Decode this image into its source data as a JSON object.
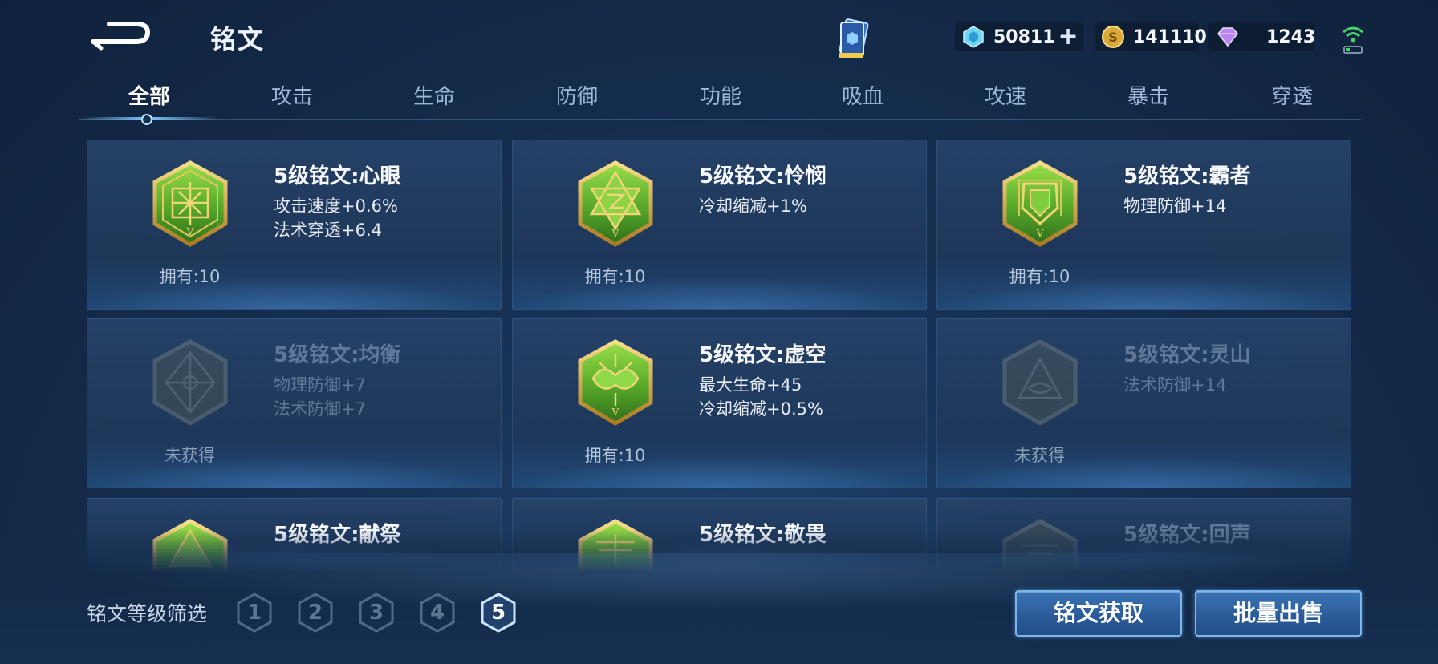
{
  "header": {
    "title": "铭文",
    "currencies": {
      "gems": "50811",
      "coins": "141110",
      "crystal": "1243"
    }
  },
  "tabs": [
    {
      "label": "全部",
      "active": true
    },
    {
      "label": "攻击"
    },
    {
      "label": "生命"
    },
    {
      "label": "防御"
    },
    {
      "label": "功能"
    },
    {
      "label": "吸血"
    },
    {
      "label": "攻速"
    },
    {
      "label": "暴击"
    },
    {
      "label": "穿透"
    }
  ],
  "inscriptions": [
    {
      "name": "5级铭文:心眼",
      "stat1": "攻击速度+0.6%",
      "stat2": "法术穿透+6.4",
      "count": "拥有:10",
      "owned": true
    },
    {
      "name": "5级铭文:怜悯",
      "stat1": "冷却缩减+1%",
      "stat2": "",
      "count": "拥有:10",
      "owned": true
    },
    {
      "name": "5级铭文:霸者",
      "stat1": "物理防御+14",
      "stat2": "",
      "count": "拥有:10",
      "owned": true
    },
    {
      "name": "5级铭文:均衡",
      "stat1": "物理防御+7",
      "stat2": "法术防御+7",
      "count": "未获得",
      "owned": false
    },
    {
      "name": "5级铭文:虚空",
      "stat1": "最大生命+45",
      "stat2": "冷却缩减+0.5%",
      "count": "拥有:10",
      "owned": true
    },
    {
      "name": "5级铭文:灵山",
      "stat1": "法术防御+14",
      "stat2": "",
      "count": "未获得",
      "owned": false
    },
    {
      "name": "5级铭文:献祭",
      "stat1": "",
      "stat2": "",
      "count": "",
      "owned": true
    },
    {
      "name": "5级铭文:敬畏",
      "stat1": "",
      "stat2": "",
      "count": "",
      "owned": true
    },
    {
      "name": "5级铭文:回声",
      "stat1": "",
      "stat2": "",
      "count": "",
      "owned": false
    }
  ],
  "filter": {
    "label": "铭文等级筛选",
    "levels": [
      "1",
      "2",
      "3",
      "4",
      "5"
    ],
    "selected": "5"
  },
  "actions": {
    "get_label": "铭文获取",
    "sell_label": "批量出售"
  },
  "colors": {
    "accent": "#7fc7ff",
    "emblem_green": "#5fb82e",
    "emblem_gold": "#d9b24a"
  }
}
